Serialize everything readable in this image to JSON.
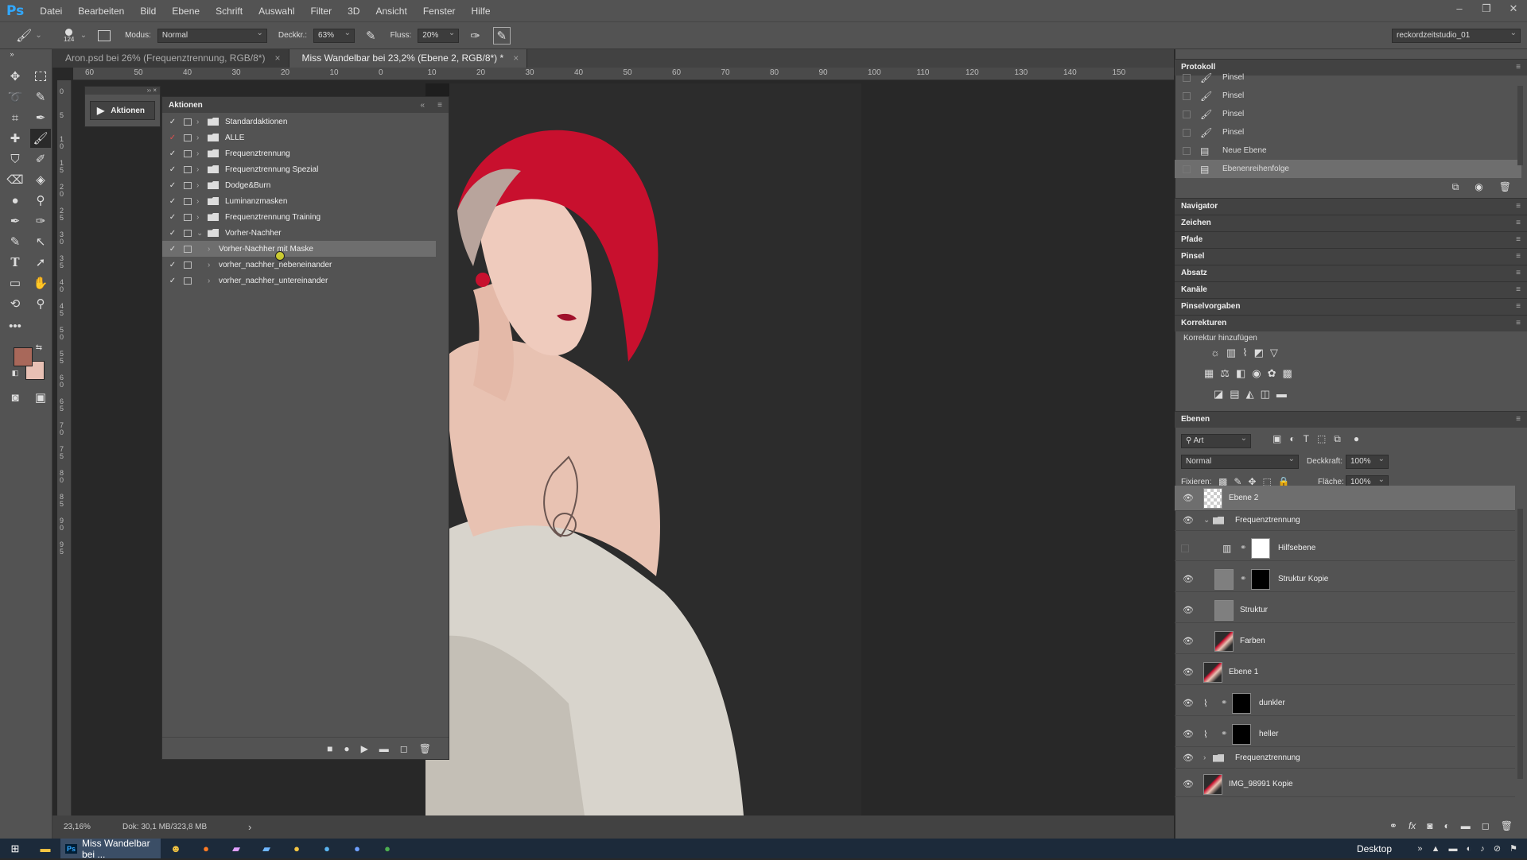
{
  "app": {
    "logo": "Ps",
    "menu": [
      "Datei",
      "Bearbeiten",
      "Bild",
      "Ebene",
      "Schrift",
      "Auswahl",
      "Filter",
      "3D",
      "Ansicht",
      "Fenster",
      "Hilfe"
    ]
  },
  "window_controls": [
    "–",
    "❐",
    "✕"
  ],
  "options": {
    "brush_size": "124",
    "mode_label": "Modus:",
    "mode_value": "Normal",
    "opacity_label": "Deckkr.:",
    "opacity_value": "63%",
    "flow_label": "Fluss:",
    "flow_value": "20%",
    "workspace": "reckordzeitstudio_01"
  },
  "tabs": [
    {
      "label": "Aron.psd bei 26% (Frequenztrennung, RGB/8*)",
      "close": "×"
    },
    {
      "label": "Miss Wandelbar bei 23,2% (Ebene 2, RGB/8*) *",
      "close": "×"
    }
  ],
  "ruler_h": [
    "60",
    "50",
    "40",
    "30",
    "20",
    "10",
    "0",
    "10",
    "20",
    "30",
    "40",
    "50",
    "60",
    "70",
    "80",
    "90",
    "100",
    "110",
    "120",
    "130",
    "140",
    "150"
  ],
  "ruler_v": [
    "0",
    "5",
    "1 0",
    "1 5",
    "2 0",
    "2 5",
    "3 0",
    "3 5",
    "4 0",
    "4 5",
    "5 0",
    "5 5",
    "6 0",
    "6 5",
    "7 0",
    "7 5",
    "8 0",
    "8 5",
    "9 0",
    "9 5"
  ],
  "status": {
    "zoom": "23,16%",
    "doc": "Dok: 30,1 MB/323,8 MB",
    "arrow": "›"
  },
  "actions_mini": {
    "label": "Aktionen"
  },
  "actions": {
    "title": "Aktionen",
    "rows": [
      {
        "label": "Standardaktionen",
        "folder": true,
        "expanded": false,
        "selected": false
      },
      {
        "label": "ALLE",
        "folder": true,
        "expanded": false,
        "selected": false
      },
      {
        "label": "Frequenztrennung",
        "folder": true,
        "expanded": false,
        "selected": false
      },
      {
        "label": "Frequenztrennung Spezial",
        "folder": true,
        "expanded": false,
        "selected": false
      },
      {
        "label": "Dodge&Burn",
        "folder": true,
        "expanded": false,
        "selected": false
      },
      {
        "label": "Luminanzmasken",
        "folder": true,
        "expanded": false,
        "selected": false
      },
      {
        "label": "Frequenztrennung Training",
        "folder": true,
        "expanded": false,
        "selected": false
      },
      {
        "label": "Vorher-Nachher",
        "folder": true,
        "expanded": true,
        "selected": false
      },
      {
        "label": "Vorher-Nachher mit Maske",
        "folder": false,
        "expanded": false,
        "selected": true
      },
      {
        "label": "vorher_nachher_nebeneinander",
        "folder": false,
        "expanded": false,
        "selected": false
      },
      {
        "label": "vorher_nachher_untereinander",
        "folder": false,
        "expanded": false,
        "selected": false
      }
    ],
    "footer": [
      "■",
      "●",
      "▶",
      "▬",
      "◻",
      "🗑"
    ]
  },
  "history": {
    "title": "Protokoll",
    "rows": [
      {
        "label": "Pinsel",
        "selected": false
      },
      {
        "label": "Pinsel",
        "selected": false
      },
      {
        "label": "Pinsel",
        "selected": false
      },
      {
        "label": "Pinsel",
        "selected": false
      },
      {
        "label": "Neue Ebene",
        "selected": false
      },
      {
        "label": "Ebenenreihenfolge",
        "selected": true
      }
    ]
  },
  "collapsed_panels": [
    "Navigator",
    "Zeichen",
    "Pfade",
    "Pinsel",
    "Absatz",
    "Kanäle",
    "Pinselvorgaben",
    "Korrekturen"
  ],
  "adjustments": {
    "label": "Korrektur hinzufügen"
  },
  "layers": {
    "title": "Ebenen",
    "filter": "Art",
    "blend": "Normal",
    "opacity_label": "Deckkraft:",
    "opacity_value": "100%",
    "lock_label": "Fixieren:",
    "fill_label": "Fläche:",
    "fill_value": "100%",
    "rows": [
      {
        "label": "Ebene 2",
        "visible": true,
        "selected": true,
        "indent": 0,
        "kind": "transparent"
      },
      {
        "label": "Frequenztrennung",
        "visible": true,
        "selected": false,
        "indent": 0,
        "kind": "group-open"
      },
      {
        "label": "Hilfsebene",
        "visible": false,
        "selected": false,
        "indent": 2,
        "kind": "adjust"
      },
      {
        "label": "Struktur Kopie",
        "visible": true,
        "selected": false,
        "indent": 1,
        "kind": "gray-mask"
      },
      {
        "label": "Struktur",
        "visible": true,
        "selected": false,
        "indent": 1,
        "kind": "gray"
      },
      {
        "label": "Farben",
        "visible": true,
        "selected": false,
        "indent": 1,
        "kind": "photo"
      },
      {
        "label": "Ebene 1",
        "visible": true,
        "selected": false,
        "indent": 0,
        "kind": "photo"
      },
      {
        "label": "dunkler",
        "visible": true,
        "selected": false,
        "indent": 0,
        "kind": "curves-mask"
      },
      {
        "label": "heller",
        "visible": true,
        "selected": false,
        "indent": 0,
        "kind": "curves-mask"
      },
      {
        "label": "Frequenztrennung",
        "visible": true,
        "selected": false,
        "indent": 0,
        "kind": "group-closed"
      },
      {
        "label": "IMG_98991 Kopie",
        "visible": true,
        "selected": false,
        "indent": 0,
        "kind": "photo"
      }
    ]
  },
  "taskbar": {
    "active_label": "Miss Wandelbar bei ...",
    "desktop": "Desktop"
  },
  "colors": {
    "foreground": "#a8685a",
    "background": "#e8c0b4",
    "hair": "#c8102e"
  }
}
